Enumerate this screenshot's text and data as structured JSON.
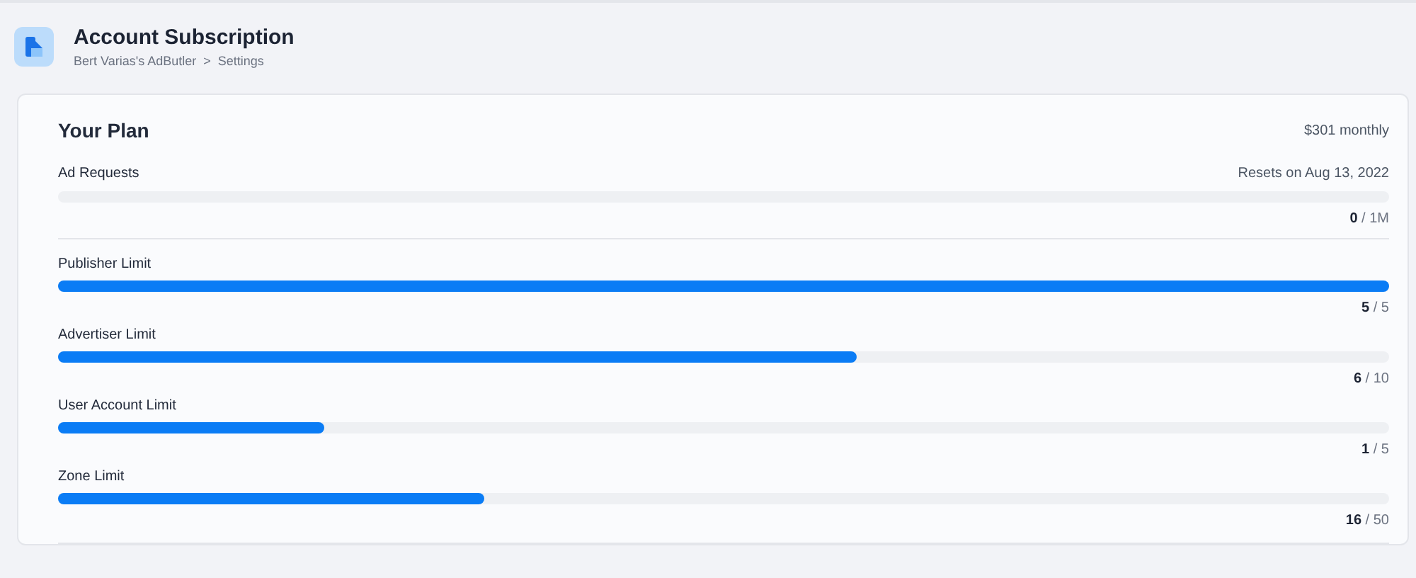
{
  "header": {
    "title": "Account Subscription",
    "breadcrumb": [
      {
        "label": "Bert Varias's AdButler"
      },
      {
        "label": ">"
      },
      {
        "label": "Settings"
      }
    ]
  },
  "plan": {
    "title": "Your Plan",
    "price": "$301 monthly",
    "ad_requests": {
      "label": "Ad Requests",
      "reset": "Resets on Aug 13, 2022",
      "count": "**0** / 1M"
    },
    "limits": [
      {
        "label": "Publisher Limit",
        "level": 1,
        "count": "**5** / 5"
      },
      {
        "label": "Advertiser Limit",
        "level": 0.6,
        "count": "**6** / 10"
      },
      {
        "label": "User Account Limit",
        "level": 0.2,
        "count": "**1** / 5"
      },
      {
        "label": "Zone Limit",
        "level": 0.32,
        "count": "**16** / 50"
      }
    ]
  }
}
